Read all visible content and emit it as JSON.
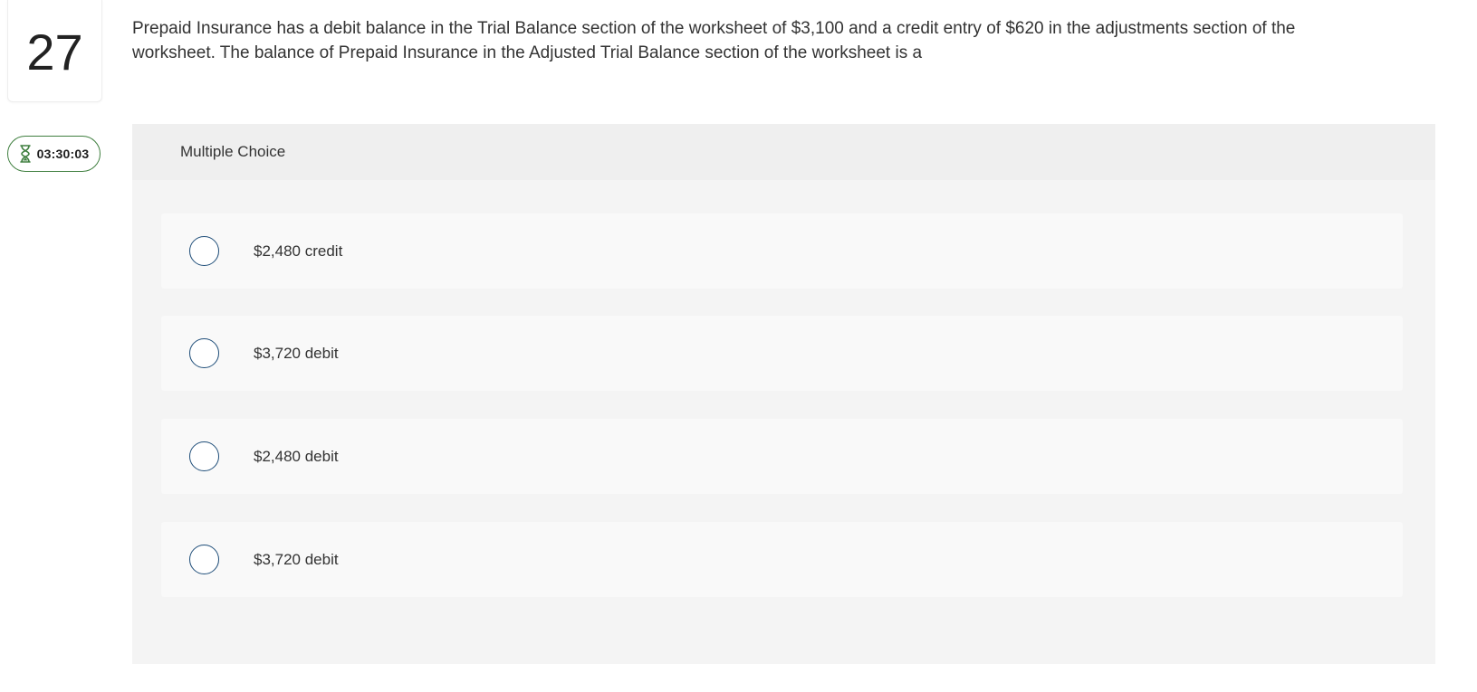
{
  "question_number": "27",
  "timer": {
    "icon": "hourglass-icon",
    "time": "03:30:03",
    "color": "#3f7f3f"
  },
  "question_text": "Prepaid Insurance has a debit balance in the Trial Balance section of the worksheet of $3,100 and a credit entry of $620 in the adjustments section of the worksheet. The balance of Prepaid Insurance in the Adjusted Trial Balance section of the worksheet is a",
  "choice_type_label": "Multiple Choice",
  "options": [
    {
      "label": "$2,480 credit",
      "selected": false
    },
    {
      "label": "$3,720 debit",
      "selected": false
    },
    {
      "label": "$2,480 debit",
      "selected": false
    },
    {
      "label": "$3,720 debit",
      "selected": false
    }
  ],
  "colors": {
    "radio_border": "#1f4e79",
    "panel_bg": "#f4f4f4",
    "header_bg": "#efefef",
    "option_bg": "#f9f9f9"
  }
}
